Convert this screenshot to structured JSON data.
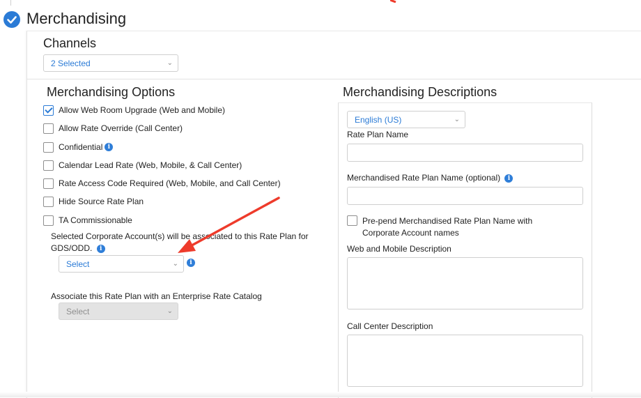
{
  "section": {
    "title": "Merchandising"
  },
  "channels": {
    "title": "Channels",
    "selected": "2 Selected"
  },
  "options": {
    "title": "Merchandising Options",
    "items": [
      {
        "label": "Allow Web Room Upgrade (Web and Mobile)",
        "checked": true
      },
      {
        "label": "Allow Rate Override (Call Center)",
        "checked": false
      },
      {
        "label": "Confidential",
        "checked": false,
        "info": true
      },
      {
        "label": "Calendar Lead Rate (Web, Mobile, & Call Center)",
        "checked": false
      },
      {
        "label": "Rate Access Code Required (Web, Mobile, and Call Center)",
        "checked": false
      },
      {
        "label": "Hide Source Rate Plan",
        "checked": false
      },
      {
        "label": "TA Commissionable",
        "checked": false
      }
    ],
    "corporate_text": "Selected Corporate Account(s) will be associated to this Rate Plan for GDS/ODD.",
    "corporate_select": "Select",
    "rate_catalog_label": "Associate this Rate Plan with an Enterprise Rate Catalog",
    "rate_catalog_select": "Select"
  },
  "descriptions": {
    "title": "Merchandising Descriptions",
    "language": "English (US)",
    "rate_plan_name_label": "Rate Plan Name",
    "merch_name_label": "Merchandised Rate Plan Name (optional)",
    "prepend_label": "Pre-pend Merchandised Rate Plan Name with Corporate Account names",
    "web_mobile_label": "Web and Mobile Description",
    "call_center_label": "Call Center Description"
  },
  "colors": {
    "accent": "#2b7bd6",
    "annotation_arrow": "#ee3b2b"
  },
  "icons": {
    "section_status": "check-circle-icon",
    "info": "info-icon",
    "dropdown": "chevron-down-icon",
    "annotation": "red-arrow-icon"
  }
}
